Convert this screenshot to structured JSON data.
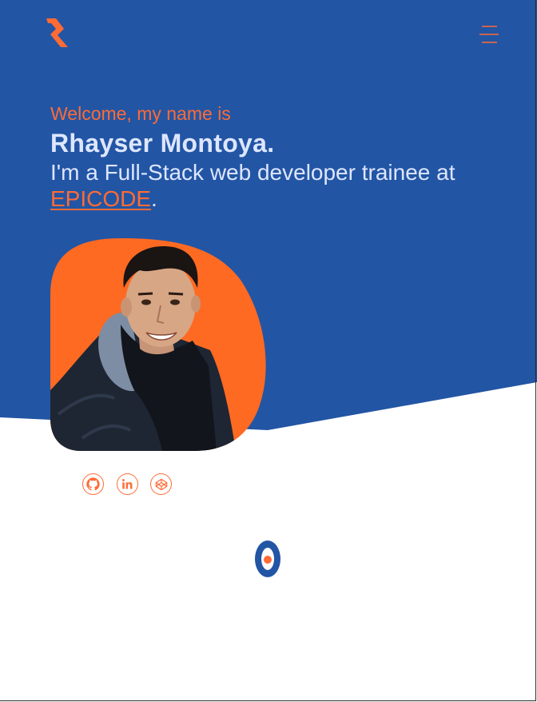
{
  "colors": {
    "primary_blue": "#2255a4",
    "accent_orange": "#ff6b35",
    "heading_light": "#dde6ff",
    "background": "#ffffff"
  },
  "header": {
    "logo_icon": "r-logo-icon",
    "menu_icon": "hamburger-menu-icon"
  },
  "hero": {
    "welcome": "Welcome, my name is",
    "name": "Rhayser Montoya.",
    "role_text": "I'm a Full-Stack web developer trainee at ",
    "company_link": "EPICODE",
    "role_end": "."
  },
  "portrait": {
    "icon": "profile-photo"
  },
  "socials": [
    {
      "icon": "github-icon"
    },
    {
      "icon": "linkedin-icon"
    },
    {
      "icon": "codepen-icon"
    }
  ],
  "scroll": {
    "icon": "scroll-down-indicator-icon"
  }
}
